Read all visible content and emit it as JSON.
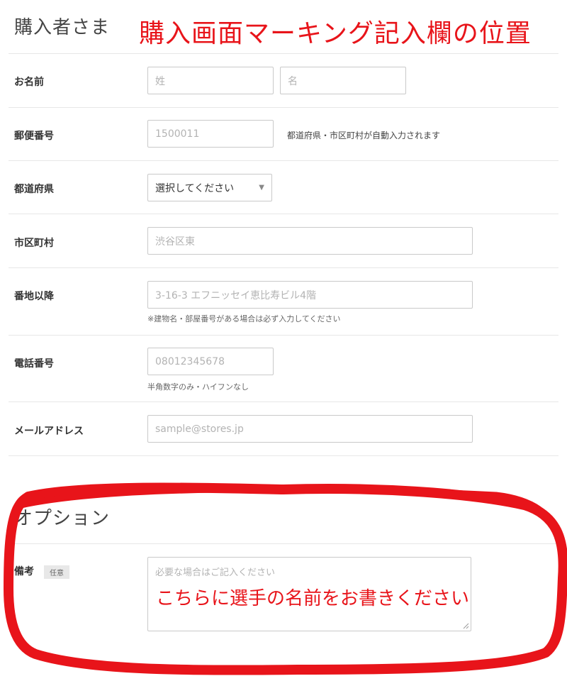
{
  "buyer_section": {
    "title": "購入者さま"
  },
  "annotation_top": "購入画面マーキング記入欄の位置",
  "fields": {
    "name": {
      "label": "お名前",
      "last_placeholder": "姓",
      "first_placeholder": "名"
    },
    "postal": {
      "label": "郵便番号",
      "placeholder": "1500011",
      "note": "都道府県・市区町村が自動入力されます"
    },
    "prefecture": {
      "label": "都道府県",
      "selected": "選択してください"
    },
    "city": {
      "label": "市区町村",
      "placeholder": "渋谷区東"
    },
    "address": {
      "label": "番地以降",
      "placeholder": "3-16-3 エフニッセイ恵比寿ビル4階",
      "hint": "※建物名・部屋番号がある場合は必ず入力してください"
    },
    "phone": {
      "label": "電話番号",
      "placeholder": "08012345678",
      "hint": "半角数字のみ・ハイフンなし"
    },
    "email": {
      "label": "メールアドレス",
      "placeholder": "sample@stores.jp"
    }
  },
  "option_section": {
    "title": "オプション",
    "remarks": {
      "label": "備考",
      "badge": "任意",
      "placeholder": "必要な場合はご記入ください",
      "annotation": "こちらに選手の名前をお書きください"
    }
  },
  "colors": {
    "annotation": "#e8141a",
    "border": "#c9c9c9",
    "rule": "#e7e7e7"
  },
  "icons": {
    "select_caret": "triangle-down-icon",
    "resize": "resize-grip-icon"
  }
}
